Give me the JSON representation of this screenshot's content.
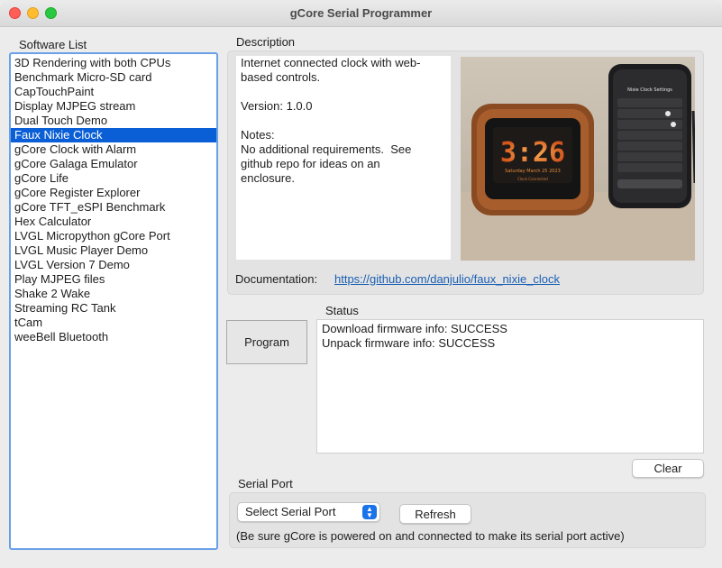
{
  "window": {
    "title": "gCore Serial Programmer"
  },
  "software_list": {
    "label": "Software List",
    "selected_index": 5,
    "items": [
      "3D Rendering with both CPUs",
      "Benchmark Micro-SD card",
      "CapTouchPaint",
      "Display MJPEG stream",
      "Dual Touch Demo",
      "Faux Nixie Clock",
      "gCore Clock with Alarm",
      "gCore Galaga Emulator",
      "gCore Life",
      "gCore Register Explorer",
      "gCore TFT_eSPI Benchmark",
      "Hex Calculator",
      "LVGL Micropython gCore Port",
      "LVGL Music Player Demo",
      "LVGL Version 7 Demo",
      "Play MJPEG files",
      "Shake 2 Wake",
      "Streaming RC Tank",
      "tCam",
      "weeBell Bluetooth"
    ]
  },
  "description": {
    "label": "Description",
    "text": "Internet connected clock with web-\nbased controls.\n\nVersion: 1.0.0\n\nNotes:\nNo additional requirements.  See\ngithub repo for ideas on an\nenclosure.",
    "photo": {
      "clock_time": "3:26",
      "clock_date": "Saturday March 25 2023",
      "clock_status": "Clock Connected",
      "phone_title": "Nixie Clock Settings"
    },
    "documentation_label": "Documentation:",
    "documentation_link": "https://github.com/danjulio/faux_nixie_clock"
  },
  "program_button": "Program",
  "status": {
    "label": "Status",
    "lines": [
      "Download firmware info: SUCCESS",
      "Unpack firmware info: SUCCESS"
    ]
  },
  "clear_button": "Clear",
  "serial_port": {
    "label": "Serial Port",
    "select_value": "Select Serial Port",
    "refresh_button": "Refresh",
    "hint": "(Be sure gCore is powered on and connected to make its serial port active)"
  },
  "colors": {
    "selection": "#0a5fd6",
    "link": "#1a5fb4",
    "list_focus_border": "#6aa0e8"
  }
}
